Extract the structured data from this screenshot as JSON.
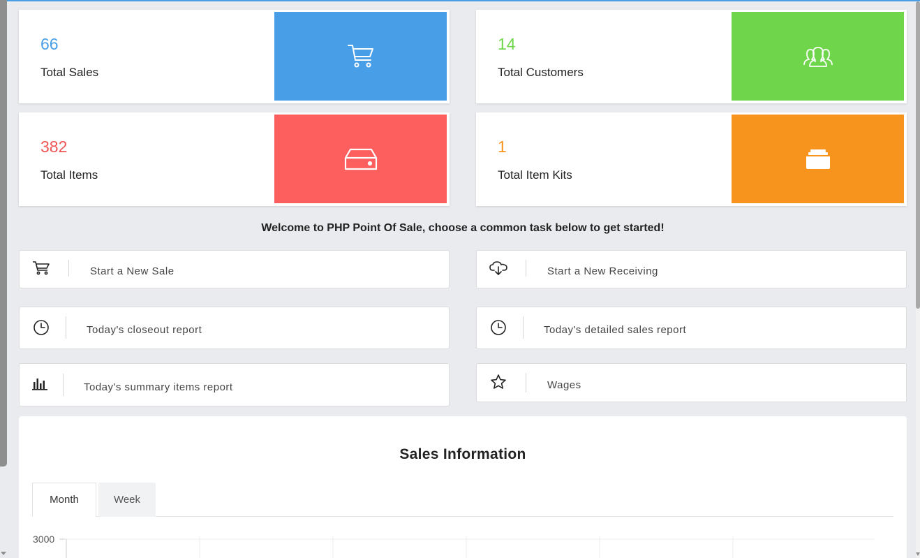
{
  "stats": [
    {
      "value": "66",
      "label": "Total Sales",
      "color": "#489ee7",
      "tile_color": "#489ee7",
      "icon": "cart-icon"
    },
    {
      "value": "14",
      "label": "Total Customers",
      "color": "#6fd64b",
      "tile_color": "#6fd64b",
      "icon": "customers-icon"
    },
    {
      "value": "382",
      "label": "Total Items",
      "color": "#f05555",
      "tile_color": "#fd5e5e",
      "icon": "hdd-icon"
    },
    {
      "value": "1",
      "label": "Total Item Kits",
      "color": "#f7941d",
      "tile_color": "#f7941d",
      "icon": "inbox-icon"
    }
  ],
  "welcome": "Welcome to PHP Point Of Sale, choose a common task below to get started!",
  "tasks": [
    {
      "label": "Start a New Sale",
      "icon": "cart-icon"
    },
    {
      "label": "Start a New Receiving",
      "icon": "cloud-download-icon"
    },
    {
      "label": "Today's closeout report",
      "icon": "clock-icon"
    },
    {
      "label": "Today's detailed sales report",
      "icon": "clock-icon"
    },
    {
      "label": "Today's summary items report",
      "icon": "bar-chart-icon"
    },
    {
      "label": "Wages",
      "icon": "star-icon"
    }
  ],
  "sales": {
    "title": "Sales Information",
    "tabs": [
      "Month",
      "Week"
    ],
    "active_tab": "Month"
  },
  "chart_data": {
    "type": "line",
    "title": "",
    "xlabel": "",
    "ylabel": "",
    "y_ticks": [
      "3000"
    ],
    "ylim_top": 3000,
    "grid": true
  }
}
